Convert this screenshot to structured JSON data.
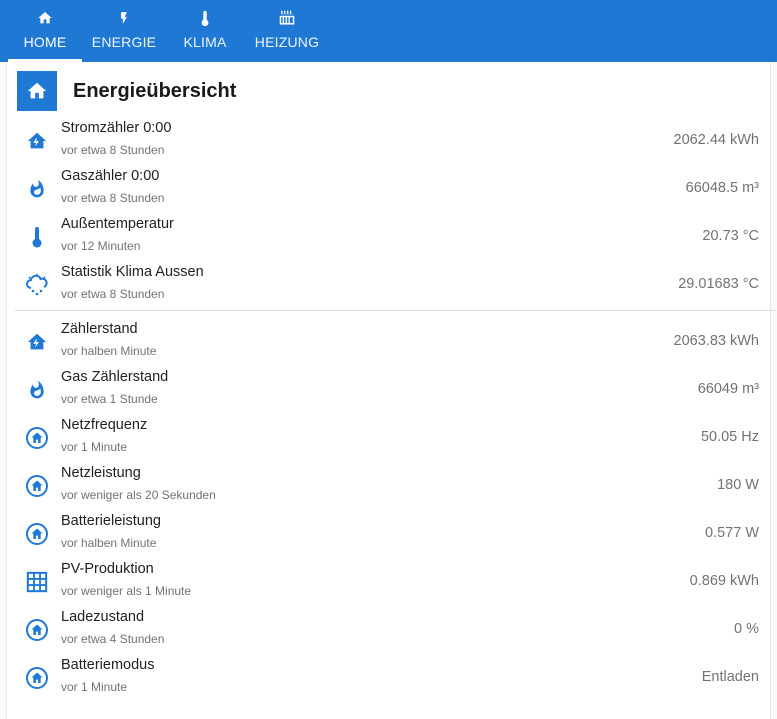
{
  "colors": {
    "accent": "#1e78d4",
    "tab_text": "#ffffff",
    "secondary_text": "#727272"
  },
  "tabs": [
    {
      "label": "HOME",
      "icon": "home-icon",
      "active": true
    },
    {
      "label": "ENERGIE",
      "icon": "lightning-icon",
      "active": false
    },
    {
      "label": "KLIMA",
      "icon": "thermometer-icon",
      "active": false
    },
    {
      "label": "HEIZUNG",
      "icon": "radiator-icon",
      "active": false
    }
  ],
  "card": {
    "title": "Energieübersicht",
    "icon": "home-icon",
    "group1": [
      {
        "name": "Stromzähler 0:00",
        "time": "vor etwa 8 Stunden",
        "value": "2062.44 kWh",
        "icon": "home-lightning-icon"
      },
      {
        "name": "Gaszähler 0:00",
        "time": "vor etwa 8 Stunden",
        "value": "66048.5 m³",
        "icon": "fire-icon"
      },
      {
        "name": "Außentemperatur",
        "time": "vor 12 Minuten",
        "value": "20.73 °C",
        "icon": "thermometer-icon"
      },
      {
        "name": "Statistik Klima Aussen",
        "time": "vor etwa 8 Stunden",
        "value": "29.01683 °C",
        "icon": "weather-snowy-icon"
      }
    ],
    "group2": [
      {
        "name": "Zählerstand",
        "time": "vor halben Minute",
        "value": "2063.83 kWh",
        "icon": "home-lightning-icon"
      },
      {
        "name": "Gas Zählerstand",
        "time": "vor etwa 1 Stunde",
        "value": "66049 m³",
        "icon": "fire-icon"
      },
      {
        "name": "Netzfrequenz",
        "time": "vor 1 Minute",
        "value": "50.05 Hz",
        "icon": "home-circle-icon"
      },
      {
        "name": "Netzleistung",
        "time": "vor weniger als 20 Sekunden",
        "value": "180 W",
        "icon": "home-circle-icon"
      },
      {
        "name": "Batterieleistung",
        "time": "vor halben Minute",
        "value": "0.577 W",
        "icon": "home-circle-icon"
      },
      {
        "name": "PV-Produktion",
        "time": "vor weniger als 1 Minute",
        "value": "0.869 kWh",
        "icon": "solar-panel-icon"
      },
      {
        "name": "Ladezustand",
        "time": "vor etwa 4 Stunden",
        "value": "0 %",
        "icon": "home-circle-icon"
      },
      {
        "name": "Batteriemodus",
        "time": "vor 1 Minute",
        "value": "Entladen",
        "icon": "home-circle-icon"
      }
    ]
  }
}
